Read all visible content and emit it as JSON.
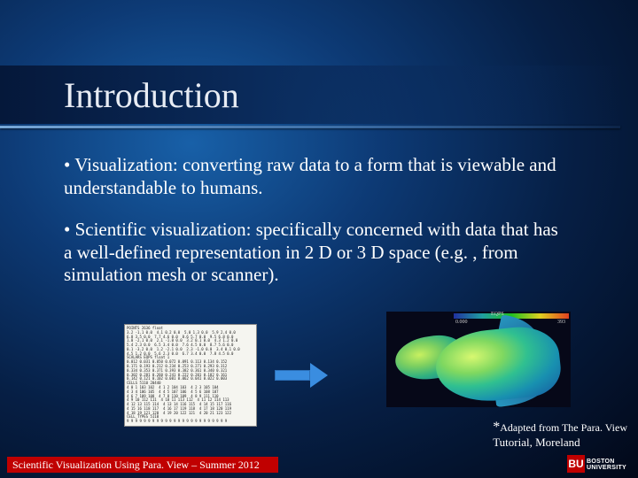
{
  "title": "Introduction",
  "bullets": [
    "• Visualization: converting raw data to a form that is viewable and understandable to humans.",
    "• Scientific visualization: specifically concerned with data that has a well-defined representation in 2 D or 3 D space (e.g. , from simulation mesh or scanner)."
  ],
  "footnote": {
    "line1": "*Adapted from The Para. View",
    "line2": "Tutorial, Moreland"
  },
  "footer": "Scientific Visualization Using Para. View – Summer 2012",
  "logo": {
    "square": "BU",
    "line1": "BOSTON",
    "line2": "UNIVERSITY"
  },
  "render_colorbar": {
    "title": "EQPS",
    "min": "0.000",
    "max": "393"
  }
}
